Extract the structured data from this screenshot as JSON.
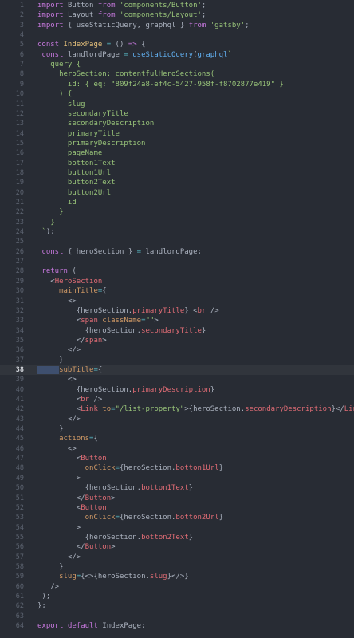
{
  "editor": {
    "active_line": 38,
    "lines": [
      {
        "n": "1",
        "tokens": [
          [
            "kw",
            "import "
          ],
          [
            "var",
            "Button "
          ],
          [
            "kw",
            "from "
          ],
          [
            "str",
            "'components/Button'"
          ],
          [
            "pun",
            ";"
          ]
        ]
      },
      {
        "n": "2",
        "tokens": [
          [
            "kw",
            "import "
          ],
          [
            "var",
            "Layout "
          ],
          [
            "kw",
            "from "
          ],
          [
            "str",
            "'components/Layout'"
          ],
          [
            "pun",
            ";"
          ]
        ]
      },
      {
        "n": "3",
        "tokens": [
          [
            "kw",
            "import "
          ],
          [
            "pun",
            "{ "
          ],
          [
            "var",
            "useStaticQuery, graphql "
          ],
          [
            "pun",
            "} "
          ],
          [
            "kw",
            "from "
          ],
          [
            "str",
            "'gatsby'"
          ],
          [
            "pun",
            ";"
          ]
        ]
      },
      {
        "n": "4",
        "tokens": []
      },
      {
        "n": "5",
        "tokens": [
          [
            "kw",
            "const "
          ],
          [
            "cls",
            "IndexPage "
          ],
          [
            "op",
            "= "
          ],
          [
            "pun",
            "() "
          ],
          [
            "kw",
            "=> "
          ],
          [
            "pun",
            "{"
          ]
        ]
      },
      {
        "n": "6",
        "tokens": [
          [
            "pun",
            " "
          ],
          [
            "kw",
            "const "
          ],
          [
            "var",
            "landlordPage "
          ],
          [
            "op",
            "= "
          ],
          [
            "fn",
            "useStaticQuery"
          ],
          [
            "pun",
            "("
          ],
          [
            "fn",
            "graphql"
          ],
          [
            "str",
            "`"
          ]
        ]
      },
      {
        "n": "7",
        "tokens": [
          [
            "str",
            "   query {"
          ]
        ]
      },
      {
        "n": "8",
        "tokens": [
          [
            "str",
            "     heroSection: contentfulHeroSections("
          ]
        ]
      },
      {
        "n": "9",
        "tokens": [
          [
            "str",
            "       id: { eq: \"809f24a8-ef4c-5427-958f-f8702877e419\" }"
          ]
        ]
      },
      {
        "n": "10",
        "tokens": [
          [
            "str",
            "     ) {"
          ]
        ]
      },
      {
        "n": "11",
        "tokens": [
          [
            "str",
            "       slug"
          ]
        ]
      },
      {
        "n": "12",
        "tokens": [
          [
            "str",
            "       secondaryTitle"
          ]
        ]
      },
      {
        "n": "13",
        "tokens": [
          [
            "str",
            "       secondaryDescription"
          ]
        ]
      },
      {
        "n": "14",
        "tokens": [
          [
            "str",
            "       primaryTitle"
          ]
        ]
      },
      {
        "n": "15",
        "tokens": [
          [
            "str",
            "       primaryDescription"
          ]
        ]
      },
      {
        "n": "16",
        "tokens": [
          [
            "str",
            "       pageName"
          ]
        ]
      },
      {
        "n": "17",
        "tokens": [
          [
            "str",
            "       botton1Text"
          ]
        ]
      },
      {
        "n": "18",
        "tokens": [
          [
            "str",
            "       button1Url"
          ]
        ]
      },
      {
        "n": "19",
        "tokens": [
          [
            "str",
            "       button2Text"
          ]
        ]
      },
      {
        "n": "20",
        "tokens": [
          [
            "str",
            "       button2Url"
          ]
        ]
      },
      {
        "n": "21",
        "tokens": [
          [
            "str",
            "       id"
          ]
        ]
      },
      {
        "n": "22",
        "tokens": [
          [
            "str",
            "     }"
          ]
        ]
      },
      {
        "n": "23",
        "tokens": [
          [
            "str",
            "   }"
          ]
        ]
      },
      {
        "n": "24",
        "tokens": [
          [
            "str",
            " `"
          ],
          [
            "pun",
            ");"
          ]
        ]
      },
      {
        "n": "25",
        "tokens": []
      },
      {
        "n": "26",
        "tokens": [
          [
            "pun",
            " "
          ],
          [
            "kw",
            "const "
          ],
          [
            "pun",
            "{ "
          ],
          [
            "var",
            "heroSection "
          ],
          [
            "pun",
            "} "
          ],
          [
            "op",
            "= "
          ],
          [
            "var",
            "landlordPage"
          ],
          [
            "pun",
            ";"
          ]
        ]
      },
      {
        "n": "27",
        "tokens": []
      },
      {
        "n": "28",
        "tokens": [
          [
            "pun",
            " "
          ],
          [
            "kw",
            "return "
          ],
          [
            "pun",
            "("
          ]
        ]
      },
      {
        "n": "29",
        "tokens": [
          [
            "pun",
            "   <"
          ],
          [
            "tag",
            "HeroSection"
          ]
        ]
      },
      {
        "n": "30",
        "tokens": [
          [
            "pun",
            "     "
          ],
          [
            "att",
            "mainTitle"
          ],
          [
            "op",
            "="
          ],
          [
            "pun",
            "{"
          ]
        ]
      },
      {
        "n": "31",
        "tokens": [
          [
            "pun",
            "       <>"
          ]
        ]
      },
      {
        "n": "32",
        "tokens": [
          [
            "pun",
            "         {"
          ],
          [
            "var",
            "heroSection."
          ],
          [
            "prop",
            "primaryTitle"
          ],
          [
            "pun",
            "} <"
          ],
          [
            "tag",
            "br "
          ],
          [
            "pun",
            "/>"
          ]
        ]
      },
      {
        "n": "33",
        "tokens": [
          [
            "pun",
            "         <"
          ],
          [
            "tag",
            "span "
          ],
          [
            "att",
            "className"
          ],
          [
            "op",
            "="
          ],
          [
            "str",
            "\"\""
          ],
          [
            "pun",
            ">"
          ]
        ]
      },
      {
        "n": "34",
        "tokens": [
          [
            "pun",
            "           {"
          ],
          [
            "var",
            "heroSection."
          ],
          [
            "prop",
            "secondaryTitle"
          ],
          [
            "pun",
            "}"
          ]
        ]
      },
      {
        "n": "35",
        "tokens": [
          [
            "pun",
            "         </"
          ],
          [
            "tag",
            "span"
          ],
          [
            "pun",
            ">"
          ]
        ]
      },
      {
        "n": "36",
        "tokens": [
          [
            "pun",
            "       </>"
          ]
        ]
      },
      {
        "n": "37",
        "tokens": [
          [
            "pun",
            "     }"
          ]
        ]
      },
      {
        "n": "38",
        "tokens": [
          [
            "sel",
            "     "
          ],
          [
            "att",
            "subTitle"
          ],
          [
            "op",
            "="
          ],
          [
            "pun",
            "{"
          ]
        ]
      },
      {
        "n": "39",
        "tokens": [
          [
            "pun",
            "       <>"
          ]
        ]
      },
      {
        "n": "40",
        "tokens": [
          [
            "pun",
            "         {"
          ],
          [
            "var",
            "heroSection."
          ],
          [
            "prop",
            "primaryDescription"
          ],
          [
            "pun",
            "}"
          ]
        ]
      },
      {
        "n": "41",
        "tokens": [
          [
            "pun",
            "         <"
          ],
          [
            "tag",
            "br "
          ],
          [
            "pun",
            "/>"
          ]
        ]
      },
      {
        "n": "42",
        "tokens": [
          [
            "pun",
            "         <"
          ],
          [
            "tag",
            "Link "
          ],
          [
            "att",
            "to"
          ],
          [
            "op",
            "="
          ],
          [
            "str",
            "\"/list-property\""
          ],
          [
            "pun",
            ">{"
          ],
          [
            "var",
            "heroSection."
          ],
          [
            "prop",
            "secondaryDescription"
          ],
          [
            "pun",
            "}</"
          ],
          [
            "tag",
            "Link"
          ],
          [
            "pun",
            ">"
          ]
        ]
      },
      {
        "n": "43",
        "tokens": [
          [
            "pun",
            "       </>"
          ]
        ]
      },
      {
        "n": "44",
        "tokens": [
          [
            "pun",
            "     }"
          ]
        ]
      },
      {
        "n": "45",
        "tokens": [
          [
            "pun",
            "     "
          ],
          [
            "att",
            "actions"
          ],
          [
            "op",
            "="
          ],
          [
            "pun",
            "{"
          ]
        ]
      },
      {
        "n": "46",
        "tokens": [
          [
            "pun",
            "       <>"
          ]
        ]
      },
      {
        "n": "47",
        "tokens": [
          [
            "pun",
            "         <"
          ],
          [
            "tag",
            "Button"
          ]
        ]
      },
      {
        "n": "48",
        "tokens": [
          [
            "pun",
            "           "
          ],
          [
            "att",
            "onClick"
          ],
          [
            "op",
            "="
          ],
          [
            "pun",
            "{"
          ],
          [
            "var",
            "heroSection."
          ],
          [
            "prop",
            "botton1Url"
          ],
          [
            "pun",
            "}"
          ]
        ]
      },
      {
        "n": "49",
        "tokens": [
          [
            "pun",
            "         >"
          ]
        ]
      },
      {
        "n": "50",
        "tokens": [
          [
            "pun",
            "           {"
          ],
          [
            "var",
            "heroSection."
          ],
          [
            "prop",
            "botton1Text"
          ],
          [
            "pun",
            "}"
          ]
        ]
      },
      {
        "n": "51",
        "tokens": [
          [
            "pun",
            "         </"
          ],
          [
            "tag",
            "Button"
          ],
          [
            "pun",
            ">"
          ]
        ]
      },
      {
        "n": "52",
        "tokens": [
          [
            "pun",
            "         <"
          ],
          [
            "tag",
            "Button"
          ]
        ]
      },
      {
        "n": "53",
        "tokens": [
          [
            "pun",
            "           "
          ],
          [
            "att",
            "onClick"
          ],
          [
            "op",
            "="
          ],
          [
            "pun",
            "{"
          ],
          [
            "var",
            "heroSection."
          ],
          [
            "prop",
            "botton2Url"
          ],
          [
            "pun",
            "}"
          ]
        ]
      },
      {
        "n": "54",
        "tokens": [
          [
            "pun",
            "         >"
          ]
        ]
      },
      {
        "n": "55",
        "tokens": [
          [
            "pun",
            "           {"
          ],
          [
            "var",
            "heroSection."
          ],
          [
            "prop",
            "botton2Text"
          ],
          [
            "pun",
            "}"
          ]
        ]
      },
      {
        "n": "56",
        "tokens": [
          [
            "pun",
            "         </"
          ],
          [
            "tag",
            "Button"
          ],
          [
            "pun",
            ">"
          ]
        ]
      },
      {
        "n": "57",
        "tokens": [
          [
            "pun",
            "       </>"
          ]
        ]
      },
      {
        "n": "58",
        "tokens": [
          [
            "pun",
            "     }"
          ]
        ]
      },
      {
        "n": "59",
        "tokens": [
          [
            "pun",
            "     "
          ],
          [
            "att",
            "slug"
          ],
          [
            "op",
            "="
          ],
          [
            "pun",
            "{<>{"
          ],
          [
            "var",
            "heroSection."
          ],
          [
            "prop",
            "slug"
          ],
          [
            "pun",
            "}</>}"
          ]
        ]
      },
      {
        "n": "60",
        "tokens": [
          [
            "pun",
            "   />"
          ]
        ]
      },
      {
        "n": "61",
        "tokens": [
          [
            "pun",
            " );"
          ]
        ]
      },
      {
        "n": "62",
        "tokens": [
          [
            "pun",
            "};"
          ]
        ]
      },
      {
        "n": "63",
        "tokens": []
      },
      {
        "n": "64",
        "tokens": [
          [
            "kw",
            "export "
          ],
          [
            "kw",
            "default "
          ],
          [
            "var",
            "IndexPage"
          ],
          [
            "pun",
            ";"
          ]
        ]
      }
    ]
  }
}
